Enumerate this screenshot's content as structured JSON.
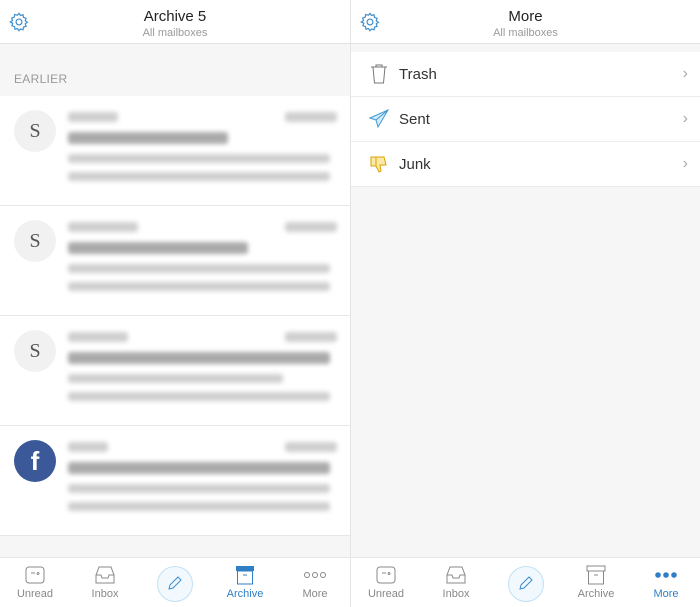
{
  "left": {
    "title": "Archive 5",
    "subtitle": "All mailboxes",
    "section": "EARLIER",
    "mails": [
      {
        "avatar": "S"
      },
      {
        "avatar": "S"
      },
      {
        "avatar": "S"
      },
      {
        "avatar": "f"
      }
    ]
  },
  "right": {
    "title": "More",
    "subtitle": "All mailboxes",
    "items": [
      {
        "label": "Trash",
        "icon": "trash-icon"
      },
      {
        "label": "Sent",
        "icon": "paper-plane-icon"
      },
      {
        "label": "Junk",
        "icon": "thumbs-down-icon"
      }
    ]
  },
  "tabs": {
    "unread": "Unread",
    "inbox": "Inbox",
    "archive": "Archive",
    "more": "More"
  },
  "colors": {
    "accent": "#2f7fc6",
    "facebook": "#3b5998"
  }
}
